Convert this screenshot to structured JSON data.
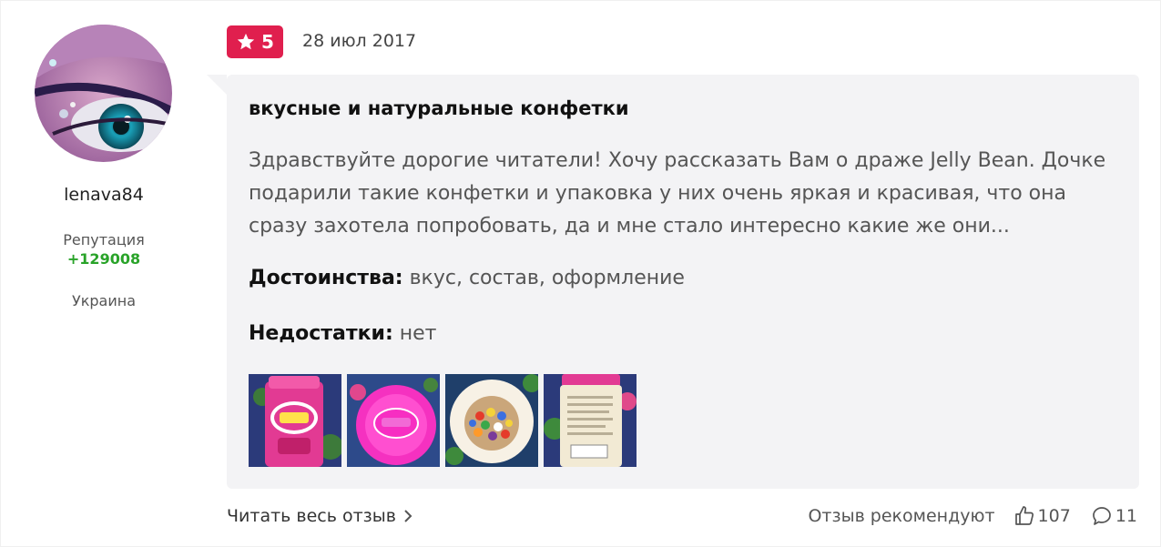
{
  "author": {
    "username": "lenava84",
    "reputation_label": "Репутация",
    "reputation_value": "+129008",
    "country": "Украина",
    "avatar_icon": "avatar-eye-makeup"
  },
  "review": {
    "rating": "5",
    "rating_icon": "star-icon",
    "date": "28 июл 2017",
    "title": "вкусные и натуральные конфетки",
    "text": "Здравствуйте дорогие читатели! Хочу рассказать Вам о драже Jelly Bean. Дочке подарили такие конфетки и упаковка у них очень яркая и красивая, что она сразу захотела попробовать, да и мне стало интересно какие же они...",
    "pros_label": "Достоинства:",
    "pros_value": "вкус, состав, оформление",
    "cons_label": "Недостатки:",
    "cons_value": "нет",
    "photos": [
      {
        "name": "photo-jar-front"
      },
      {
        "name": "photo-jar-lid"
      },
      {
        "name": "photo-jar-open"
      },
      {
        "name": "photo-jar-back"
      }
    ]
  },
  "footer": {
    "read_more": "Читать весь отзыв",
    "recommend_label": "Отзыв рекомендуют",
    "likes": "107",
    "comments": "11"
  },
  "colors": {
    "accent": "#e01f4e",
    "reputation": "#29a329",
    "bubble": "#f3f3f5"
  }
}
